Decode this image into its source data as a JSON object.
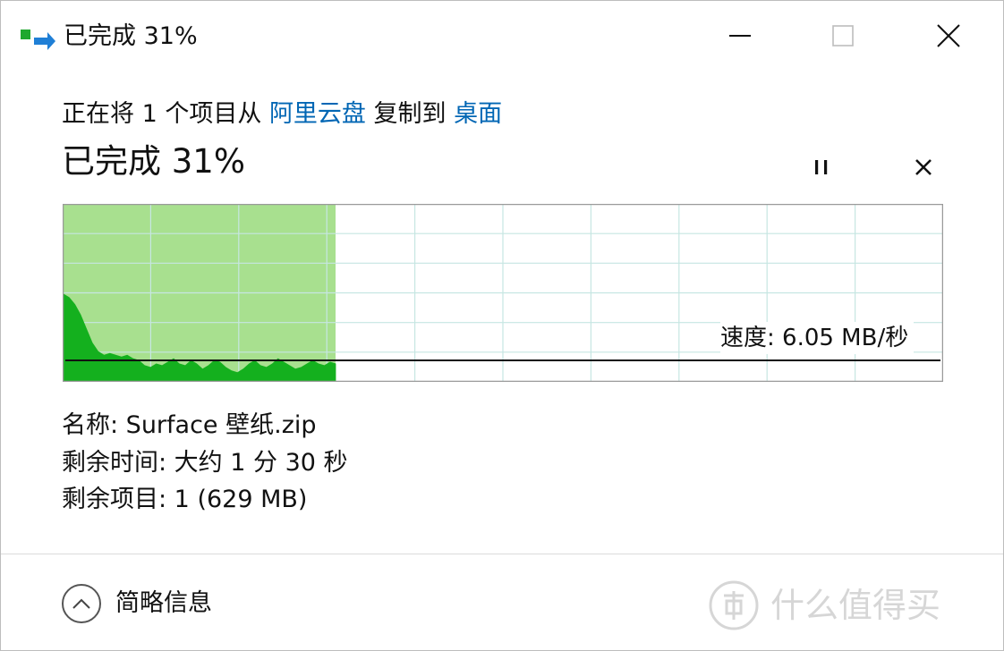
{
  "window": {
    "title": "已完成 31%",
    "icon": "copy-file-icon",
    "minimize_icon": "minimize-icon",
    "maximize_icon": "maximize-icon",
    "close_icon": "close-icon"
  },
  "operation": {
    "prefix": "正在将 1 个项目从 ",
    "source": "阿里云盘",
    "middle": " 复制到 ",
    "destination": "桌面",
    "link_color": "#0066b4"
  },
  "status": {
    "text": "已完成 31%",
    "percent": 31,
    "pause_icon": "pause-icon",
    "cancel_icon": "cancel-icon"
  },
  "graph": {
    "speed_label": "速度: 6.05 MB/秒",
    "progress_fraction": 0.31,
    "fill_color": "#a8e08f",
    "speed_color": "#14b01e",
    "grid_color": "#c6e6e2"
  },
  "details": {
    "name": "名称: Surface 壁纸.zip",
    "time_remaining": "剩余时间: 大约 1 分 30 秒",
    "items_remaining": "剩余项目: 1 (629 MB)"
  },
  "footer": {
    "fewer_details": "简略信息",
    "fewer_icon": "chevron-up-icon",
    "watermark_text": "什么值得买",
    "watermark_icon": "zhi-logo-icon"
  }
}
